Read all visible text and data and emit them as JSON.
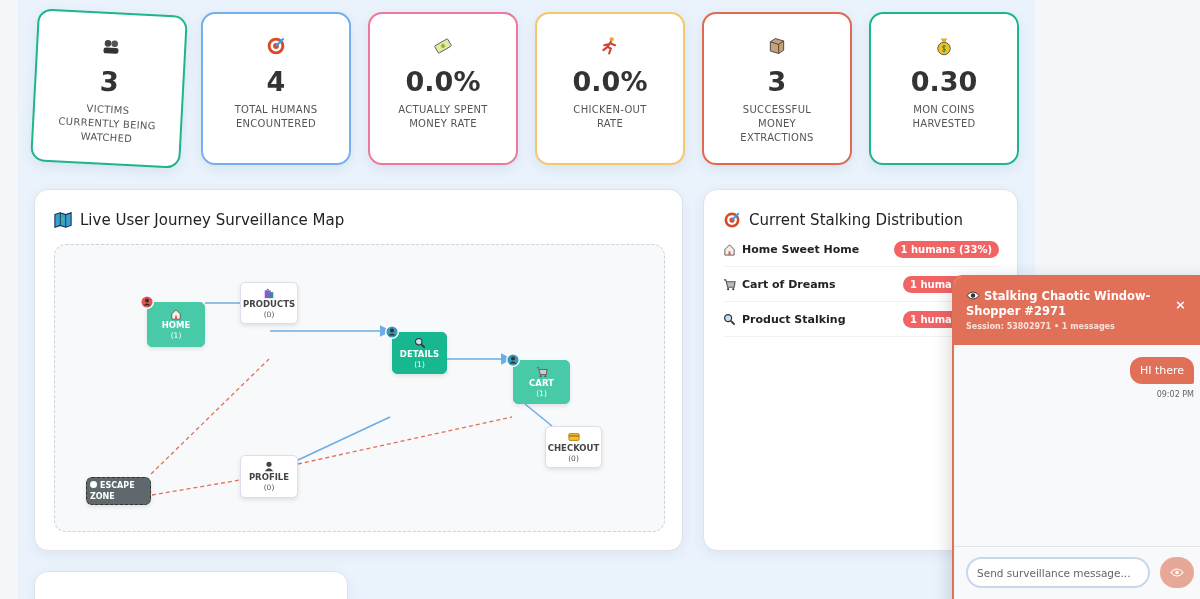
{
  "stats": [
    {
      "value": "3",
      "label": "VICTIMS CURRENTLY BEING WATCHED",
      "color": "#1db58a",
      "hovered": true
    },
    {
      "value": "4",
      "label": "TOTAL HUMANS ENCOUNTERED",
      "color": "#74b0f0",
      "hovered": false
    },
    {
      "value": "0.0%",
      "label": "ACTUALLY SPENT MONEY RATE",
      "color": "#ee78a0",
      "hovered": false
    },
    {
      "value": "0.0%",
      "label": "CHICKEN-OUT RATE",
      "color": "#f5c76a",
      "hovered": false
    },
    {
      "value": "3",
      "label": "SUCCESSFUL MONEY EXTRACTIONS",
      "color": "#e06a50",
      "hovered": false
    },
    {
      "value": "0.30",
      "label": "MON COINS HARVESTED",
      "color": "#1db58a",
      "hovered": false
    }
  ],
  "journey_map": {
    "title": "Live User Journey Surveillance Map",
    "nodes": [
      {
        "kind": "page",
        "label": "HOME",
        "count": "(1)",
        "occupied": true,
        "selected": false,
        "color": "#e05555"
      },
      {
        "kind": "page",
        "label": "PRODUCTS",
        "count": "(0)",
        "occupied": false,
        "selected": false
      },
      {
        "kind": "page",
        "label": "DETAILS",
        "count": "(1)",
        "occupied": true,
        "selected": true,
        "color": "#3a9bb8"
      },
      {
        "kind": "page",
        "label": "CART",
        "count": "(1)",
        "occupied": true,
        "selected": false,
        "color": "#3a9bb8"
      },
      {
        "kind": "page",
        "label": "CHECKOUT",
        "count": "(0)",
        "occupied": false,
        "selected": false
      },
      {
        "kind": "page",
        "label": "PROFILE",
        "count": "(0)",
        "occupied": false,
        "selected": false
      },
      {
        "kind": "exit",
        "label": "ESCAPE ZONE"
      }
    ]
  },
  "distribution": {
    "title": "Current Stalking Distribution",
    "rows": [
      {
        "label": "Home Sweet Home",
        "badge": "1 humans (33%)"
      },
      {
        "label": "Cart of Dreams",
        "badge": "1 huma"
      },
      {
        "label": "Product Stalking",
        "badge": "1 huma"
      }
    ]
  },
  "chat": {
    "title": "Stalking Chaotic Window-Shopper #2971",
    "close": "×",
    "session": "Session: 53802971 • 1 messages",
    "messages": [
      {
        "text": "HI there",
        "time": "09:02 PM"
      }
    ],
    "input": {
      "placeholder": "Send surveillance message..."
    }
  }
}
